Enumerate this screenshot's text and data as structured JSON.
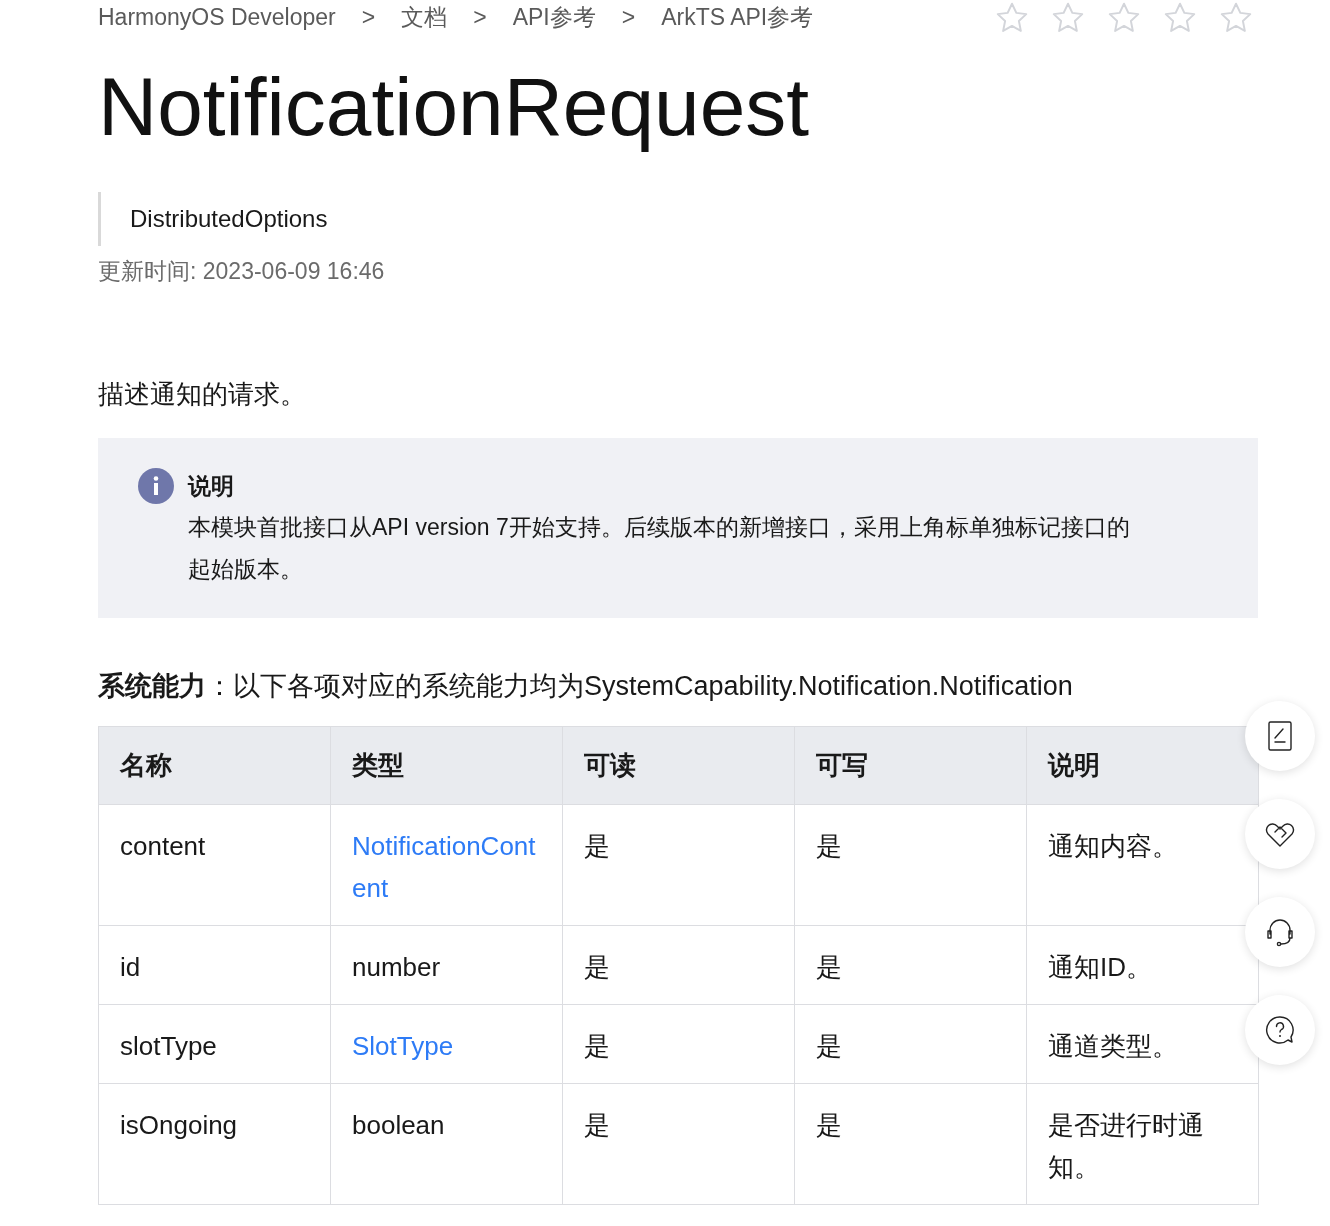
{
  "breadcrumb": [
    {
      "label": "HarmonyOS Developer",
      "separator": ">"
    },
    {
      "label": "文档",
      "separator": ">"
    },
    {
      "label": "API参考",
      "separator": ">"
    },
    {
      "label": "ArkTS API参考"
    }
  ],
  "rating": {
    "stars": 0
  },
  "title": "NotificationRequest",
  "quote": "DistributedOptions",
  "updated": "更新时间: 2023-06-09 16:46",
  "description": "描述通知的请求。",
  "note": {
    "title": "说明",
    "text": "本模块首批接口从API version 7开始支持。后续版本的新增接口，采用上角标单独标记接口的起始版本。"
  },
  "capability": "**系统能力**：以下各项对应的系统能力均为SystemCapability.Notification.Notification",
  "table": {
    "columns": [
      "名称",
      "类型",
      "可读",
      "可写",
      "说明"
    ],
    "rows": [
      [
        {
          "text": "content"
        },
        {
          "text": "NotificationContent",
          "kind": "link"
        },
        {
          "text": "是"
        },
        {
          "text": "是"
        },
        {
          "text": "通知内容。"
        }
      ],
      [
        {
          "text": "id"
        },
        {
          "text": "number"
        },
        {
          "text": "是"
        },
        {
          "text": "是"
        },
        {
          "text": "通知ID。"
        }
      ],
      [
        {
          "text": "slotType"
        },
        {
          "text": "SlotType",
          "kind": "link"
        },
        {
          "text": "是"
        },
        {
          "text": "是"
        },
        {
          "text": "通道类型。"
        }
      ],
      [
        {
          "text": "isOngoing"
        },
        {
          "text": "boolean"
        },
        {
          "text": "是"
        },
        {
          "text": "是"
        },
        {
          "text": "是否进行时通知。"
        }
      ]
    ]
  },
  "side_buttons": [
    {
      "kind": "edit"
    },
    {
      "kind": "heart"
    },
    {
      "kind": "headset"
    },
    {
      "kind": "help"
    }
  ]
}
